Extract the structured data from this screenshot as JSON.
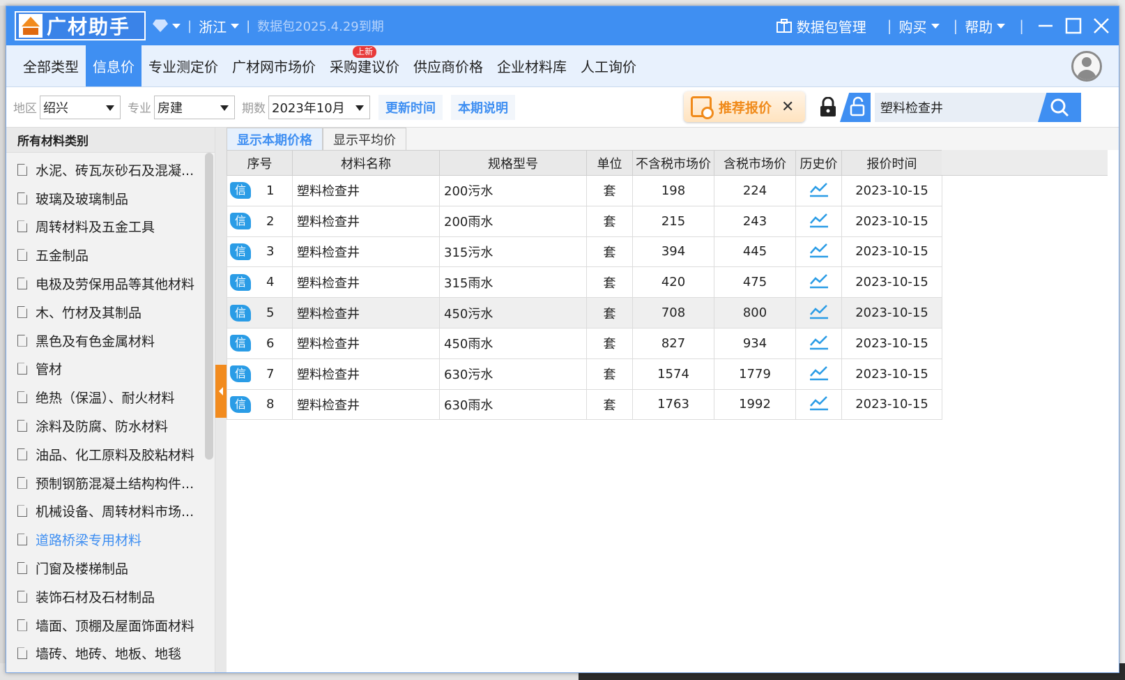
{
  "app": {
    "logo_text": "广材助手",
    "region": "浙江",
    "package_status": "数据包2025.4.29到期",
    "package_mgmt": "数据包管理",
    "buy": "购买",
    "help": "帮助"
  },
  "tabs": [
    {
      "label": "全部类型"
    },
    {
      "label": "信息价"
    },
    {
      "label": "专业测定价"
    },
    {
      "label": "广材网市场价"
    },
    {
      "label": "采购建议价",
      "badge": "上新"
    },
    {
      "label": "供应商价格"
    },
    {
      "label": "企业材料库"
    },
    {
      "label": "人工询价"
    }
  ],
  "filters": {
    "area_label": "地区",
    "area_value": "绍兴",
    "major_label": "专业",
    "major_value": "房建",
    "period_label": "期数",
    "period_value": "2023年10月",
    "update_time": "更新时间",
    "period_note": "本期说明",
    "recommend": "推荐报价",
    "search_value": "塑料检查井"
  },
  "sidebar": {
    "header": "所有材料类别",
    "items": [
      "水泥、砖瓦灰砂石及混凝...",
      "玻璃及玻璃制品",
      "周转材料及五金工具",
      "五金制品",
      "电极及劳保用品等其他材料",
      "木、竹材及其制品",
      "黑色及有色金属材料",
      "管材",
      "绝热（保温）、耐火材料",
      "涂料及防腐、防水材料",
      "油品、化工原料及胶粘材料",
      "预制钢筋混凝土结构构件...",
      "机械设备、周转材料市场...",
      "道路桥梁专用材料",
      "门窗及楼梯制品",
      "装饰石材及石材制品",
      "墙面、顶棚及屋面饰面材料",
      "墙砖、地砖、地板、地毯"
    ]
  },
  "subtabs": [
    "显示本期价格",
    "显示平均价"
  ],
  "table": {
    "columns": [
      "序号",
      "材料名称",
      "规格型号",
      "单位",
      "不含税市场价",
      "含税市场价",
      "历史价",
      "报价时间"
    ],
    "badge": "信",
    "rows": [
      {
        "seq": "1",
        "name": "塑料检查井",
        "spec": "200污水",
        "unit": "套",
        "price_ex": "198",
        "price_in": "224",
        "date": "2023-10-15"
      },
      {
        "seq": "2",
        "name": "塑料检查井",
        "spec": "200雨水",
        "unit": "套",
        "price_ex": "215",
        "price_in": "243",
        "date": "2023-10-15"
      },
      {
        "seq": "3",
        "name": "塑料检查井",
        "spec": "315污水",
        "unit": "套",
        "price_ex": "394",
        "price_in": "445",
        "date": "2023-10-15"
      },
      {
        "seq": "4",
        "name": "塑料检查井",
        "spec": "315雨水",
        "unit": "套",
        "price_ex": "420",
        "price_in": "475",
        "date": "2023-10-15"
      },
      {
        "seq": "5",
        "name": "塑料检查井",
        "spec": "450污水",
        "unit": "套",
        "price_ex": "708",
        "price_in": "800",
        "date": "2023-10-15"
      },
      {
        "seq": "6",
        "name": "塑料检查井",
        "spec": "450雨水",
        "unit": "套",
        "price_ex": "827",
        "price_in": "934",
        "date": "2023-10-15"
      },
      {
        "seq": "7",
        "name": "塑料检查井",
        "spec": "630污水",
        "unit": "套",
        "price_ex": "1574",
        "price_in": "1779",
        "date": "2023-10-15"
      },
      {
        "seq": "8",
        "name": "塑料检查井",
        "spec": "630雨水",
        "unit": "套",
        "price_ex": "1763",
        "price_in": "1992",
        "date": "2023-10-15"
      }
    ]
  },
  "colors": {
    "primary": "#3f8ff2",
    "accent_orange": "#f28b1e",
    "badge_red": "#e83a3a",
    "info_badge": "#2a9ce6"
  }
}
